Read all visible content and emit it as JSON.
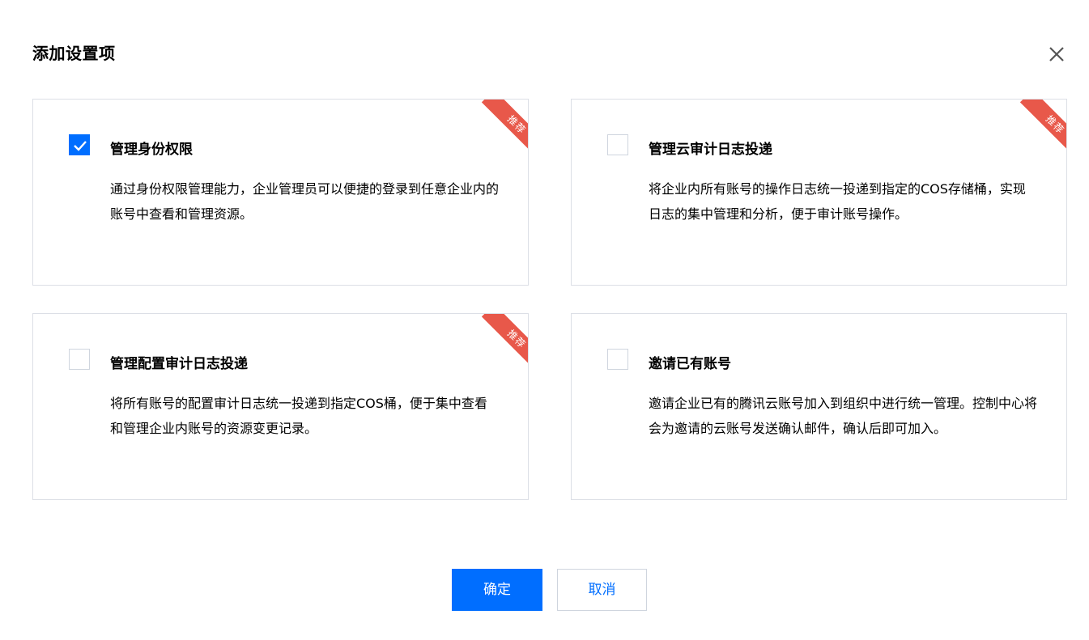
{
  "dialog": {
    "title": "添加设置项",
    "close_icon": "close-icon"
  },
  "cards": [
    {
      "title": "管理身份权限",
      "description": "通过身份权限管理能力，企业管理员可以便捷的登录到任意企业内的账号中查看和管理资源。",
      "checked": true,
      "ribbon": "推荐"
    },
    {
      "title": "管理云审计日志投递",
      "description": "将企业内所有账号的操作日志统一投递到指定的COS存储桶，实现日志的集中管理和分析，便于审计账号操作。",
      "checked": false,
      "ribbon": "推荐"
    },
    {
      "title": "管理配置审计日志投递",
      "description": "将所有账号的配置审计日志统一投递到指定COS桶，便于集中查看和管理企业内账号的资源变更记录。",
      "checked": false,
      "ribbon": "推荐"
    },
    {
      "title": "邀请已有账号",
      "description": "邀请企业已有的腾讯云账号加入到组织中进行统一管理。控制中心将会为邀请的云账号发送确认邮件，确认后即可加入。",
      "checked": false,
      "ribbon": ""
    }
  ],
  "footer": {
    "confirm_label": "确定",
    "cancel_label": "取消"
  },
  "colors": {
    "primary": "#006eff",
    "ribbon": "#e8584a",
    "border": "#dcdfe6"
  }
}
